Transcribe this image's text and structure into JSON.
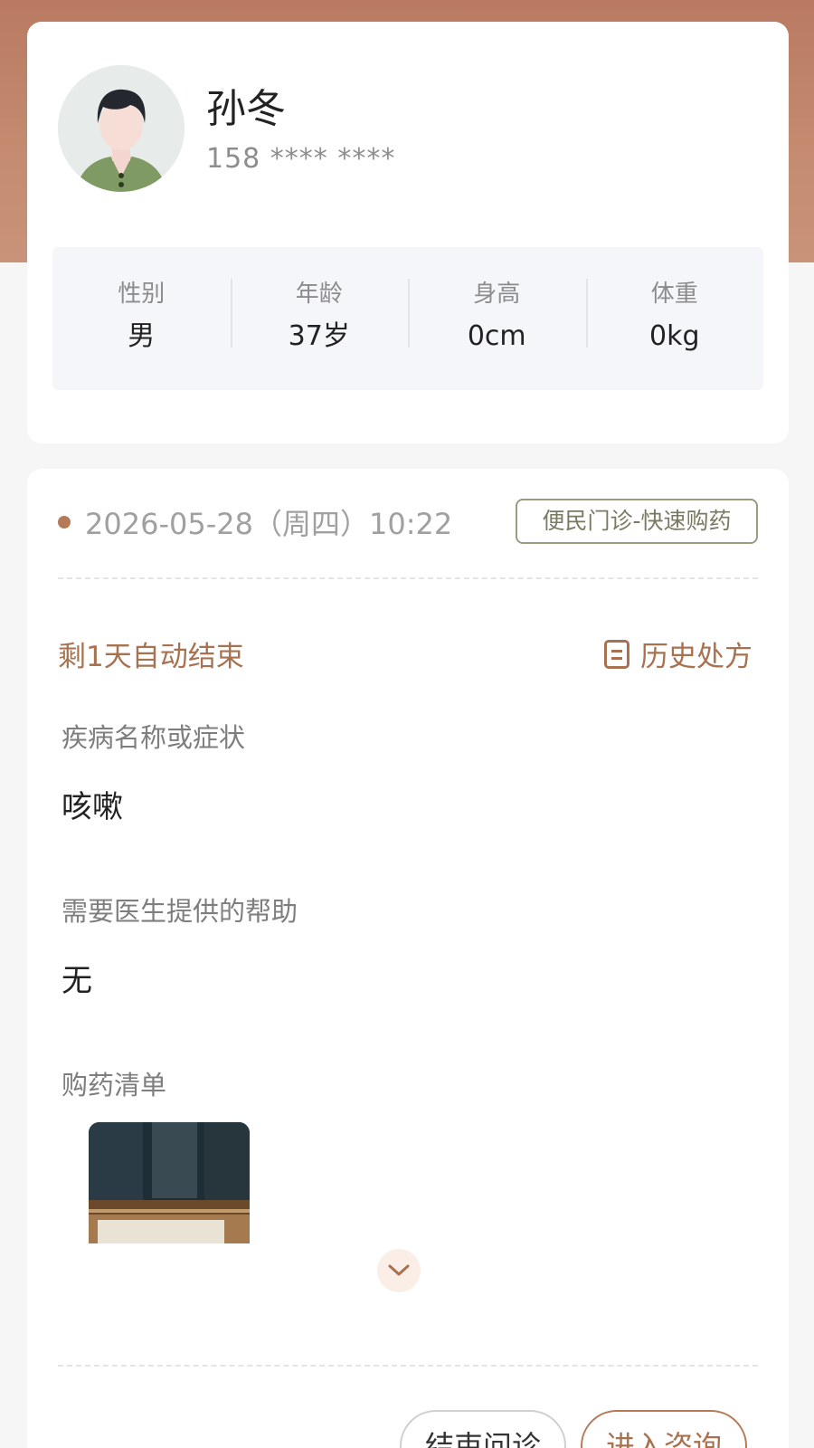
{
  "profile": {
    "name": "孙冬",
    "phone": "158 **** ****",
    "stats": [
      {
        "label": "性别",
        "value": "男"
      },
      {
        "label": "年龄",
        "value": "37岁"
      },
      {
        "label": "身高",
        "value": "0cm"
      },
      {
        "label": "体重",
        "value": "0kg"
      }
    ]
  },
  "consultation": {
    "datetime": "2026-05-28（周四）10:22",
    "tag": "便民门诊-快速购药",
    "remaining": "剩1天自动结束",
    "history_label": "历史处方",
    "fields": [
      {
        "label": "疾病名称或症状",
        "value": "咳嗽"
      },
      {
        "label": "需要医生提供的帮助",
        "value": "无"
      }
    ],
    "purchase_list_label": "购药清单",
    "buttons": {
      "end": "结束问诊",
      "enter": "进入咨询"
    }
  },
  "colors": {
    "accent": "#a87250",
    "header_bg": "#c48c70",
    "tag_border": "#9b9b83"
  }
}
